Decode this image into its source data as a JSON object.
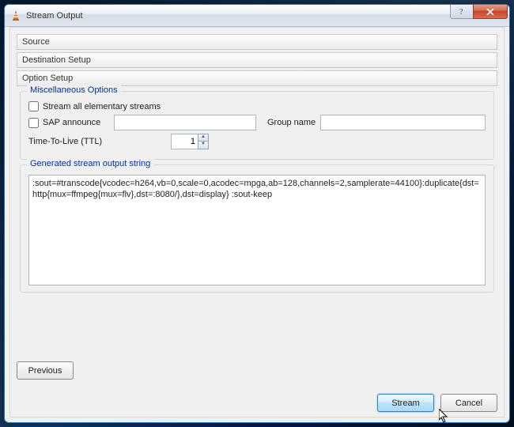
{
  "window": {
    "title": "Stream Output"
  },
  "sections": {
    "source": "Source",
    "destination": "Destination Setup",
    "option": "Option Setup"
  },
  "misc": {
    "group_title": "Miscellaneous Options",
    "stream_all_label": "Stream all elementary streams",
    "stream_all_checked": false,
    "sap_label": "SAP announce",
    "sap_checked": false,
    "sap_value": "",
    "group_name_label": "Group name",
    "group_name_value": "",
    "ttl_label": "Time-To-Live (TTL)",
    "ttl_value": "1"
  },
  "generated": {
    "group_title": "Generated stream output string",
    "value": ":sout=#transcode{vcodec=h264,vb=0,scale=0,acodec=mpga,ab=128,channels=2,samplerate=44100}:duplicate{dst=http{mux=ffmpeg{mux=flv},dst=:8080/},dst=display} :sout-keep"
  },
  "buttons": {
    "previous": "Previous",
    "stream": "Stream",
    "cancel": "Cancel"
  }
}
